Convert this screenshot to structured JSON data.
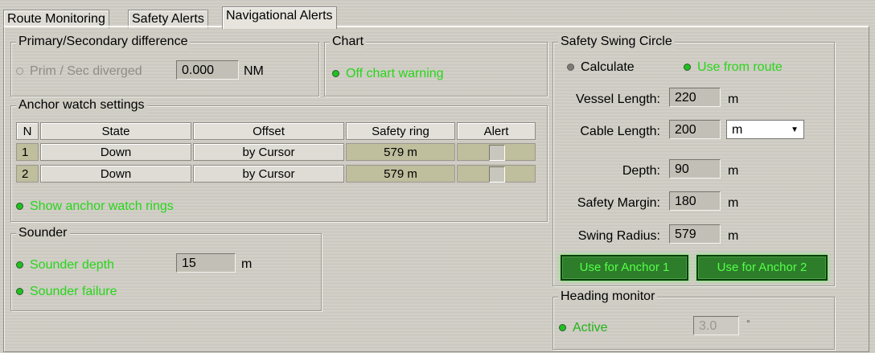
{
  "tabs": [
    {
      "label": "Route Monitoring",
      "active": false
    },
    {
      "label": "Safety Alerts",
      "active": false
    },
    {
      "label": "Navigational Alerts",
      "active": true
    }
  ],
  "primary": {
    "legend": "Primary/Secondary difference",
    "radio_label": "Prim / Sec diverged",
    "value": "0.000",
    "unit": "NM"
  },
  "chart": {
    "legend": "Chart",
    "radio_label": "Off chart warning"
  },
  "anchor": {
    "legend": "Anchor watch settings",
    "columns": [
      "N",
      "State",
      "Offset",
      "Safety ring",
      "Alert"
    ],
    "rows": [
      {
        "n": "1",
        "state": "Down",
        "offset": "by Cursor",
        "ring": "579 m"
      },
      {
        "n": "2",
        "state": "Down",
        "offset": "by Cursor",
        "ring": "579 m"
      }
    ],
    "show_rings_label": "Show anchor watch rings"
  },
  "sounder": {
    "legend": "Sounder",
    "depth_label": "Sounder depth",
    "depth_value": "15",
    "depth_unit": "m",
    "failure_label": "Sounder failure"
  },
  "swing": {
    "legend": "Safety Swing Circle",
    "calculate_label": "Calculate",
    "use_route_label": "Use from route",
    "vessel_length_label": "Vessel Length:",
    "vessel_length_value": "220",
    "vessel_length_unit": "m",
    "cable_length_label": "Cable Length:",
    "cable_length_value": "200",
    "cable_length_unit": "m",
    "depth_label": "Depth:",
    "depth_value": "90",
    "depth_unit": "m",
    "margin_label": "Safety Margin:",
    "margin_value": "180",
    "margin_unit": "m",
    "radius_label": "Swing Radius:",
    "radius_value": "579",
    "radius_unit": "m",
    "btn_anchor1": "Use for Anchor 1",
    "btn_anchor2": "Use for Anchor 2"
  },
  "heading": {
    "legend": "Heading monitor",
    "active_label": "Active",
    "value": "3.0",
    "unit": "°"
  }
}
